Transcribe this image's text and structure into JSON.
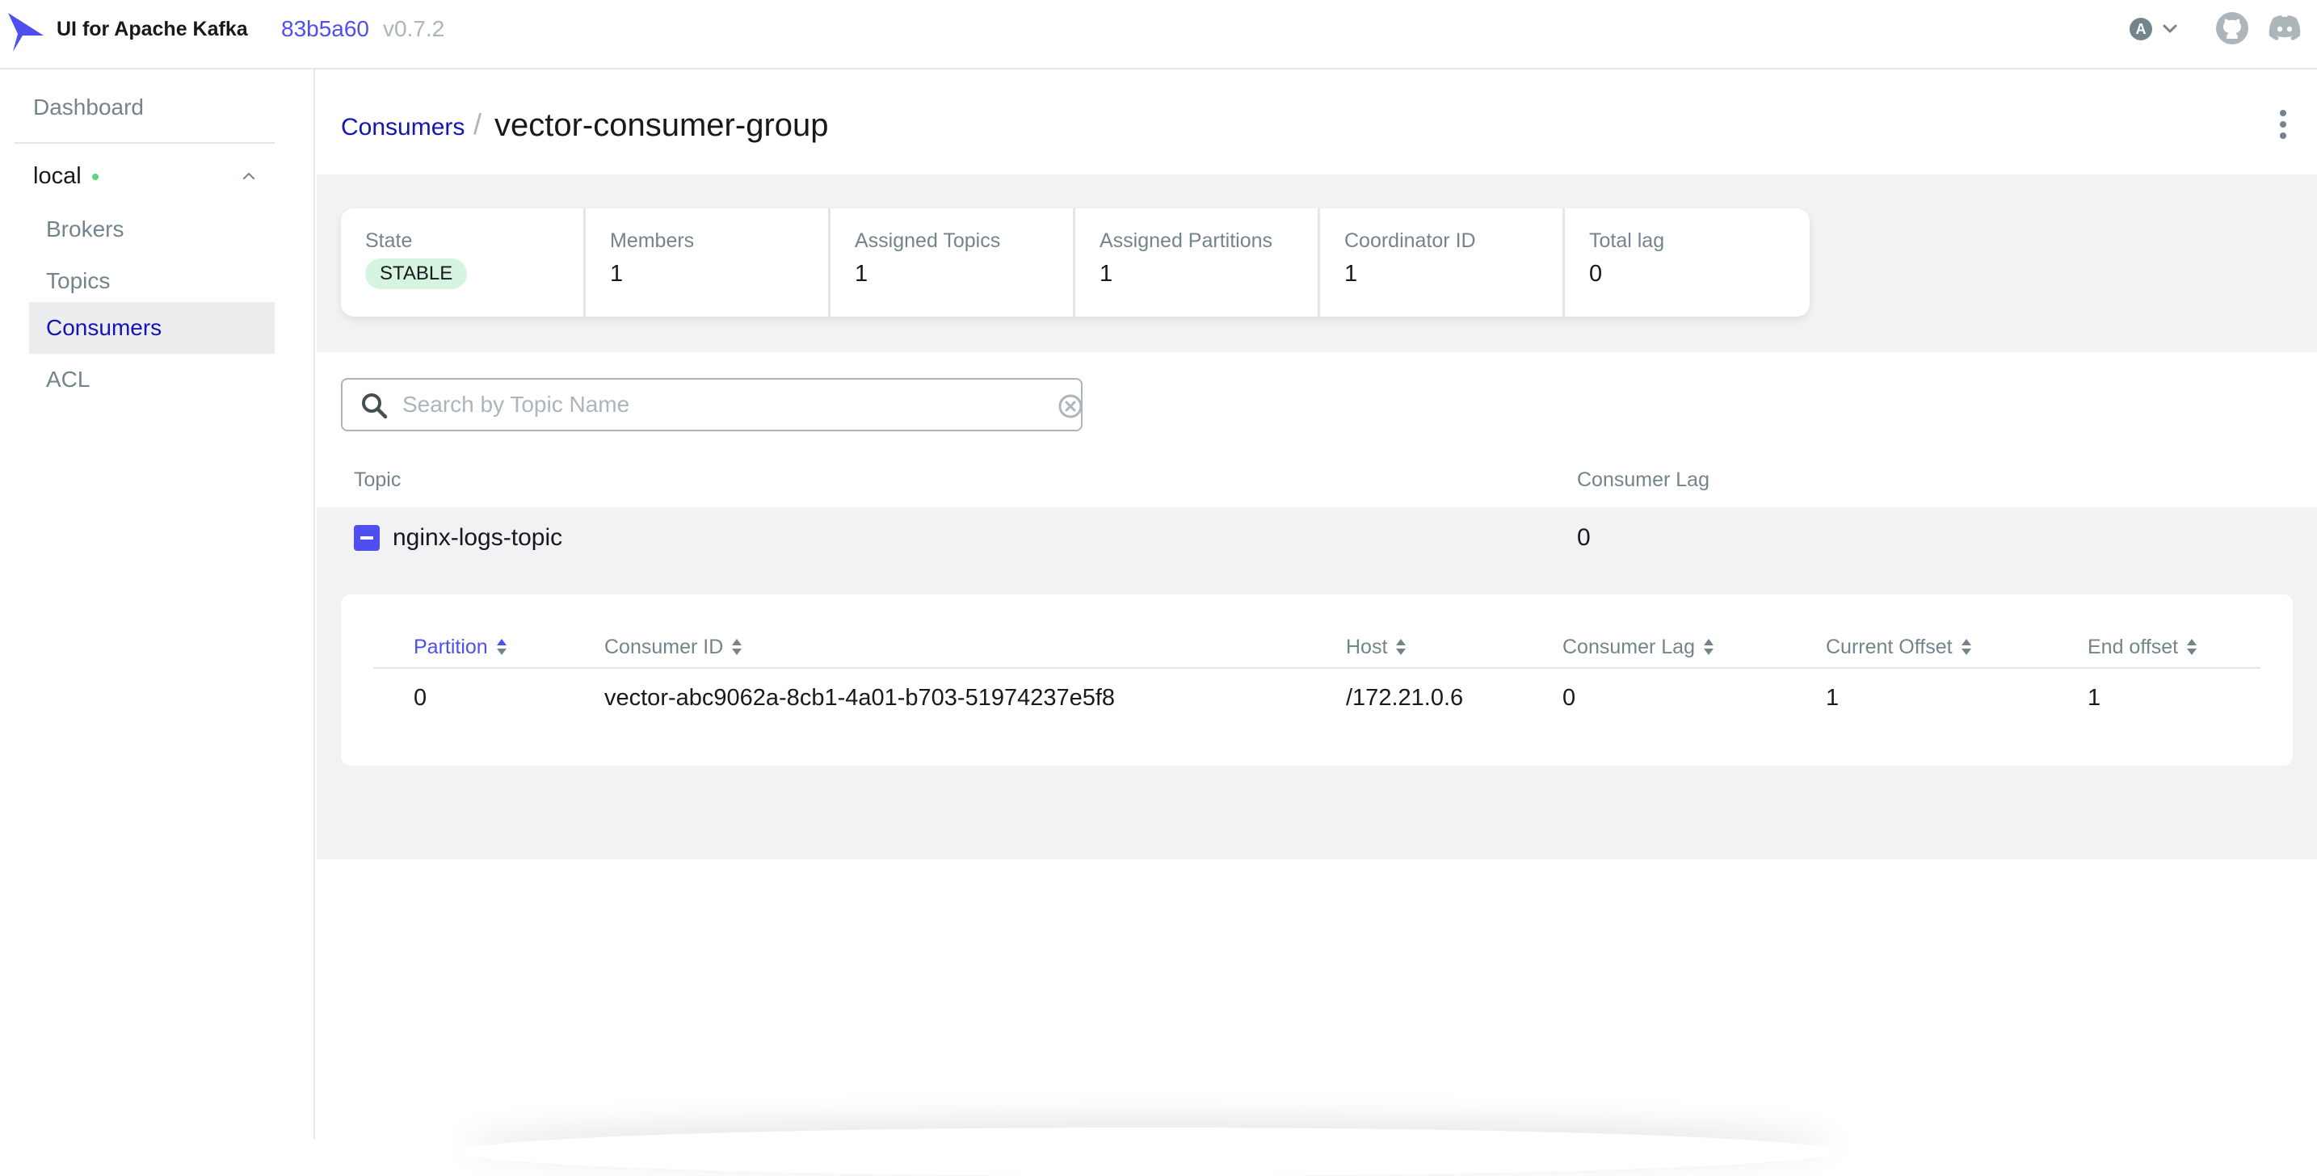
{
  "topnav": {
    "title": "UI for Apache Kafka",
    "version_hash": "83b5a60",
    "version_tag": "v0.7.2",
    "user_initial": "A"
  },
  "sidebar": {
    "dashboard_label": "Dashboard",
    "cluster_name": "local",
    "cluster_status": "online",
    "items": [
      {
        "label": "Brokers",
        "active": false
      },
      {
        "label": "Topics",
        "active": false
      },
      {
        "label": "Consumers",
        "active": true
      },
      {
        "label": "ACL",
        "active": false
      }
    ]
  },
  "header": {
    "breadcrumb_label": "Consumers",
    "separator": "/",
    "title": "vector-consumer-group"
  },
  "metrics": {
    "state_label": "State",
    "state_value": "STABLE",
    "members_label": "Members",
    "members_value": "1",
    "assigned_topics_label": "Assigned Topics",
    "assigned_topics_value": "1",
    "assigned_partitions_label": "Assigned Partitions",
    "assigned_partitions_value": "1",
    "coordinator_label": "Coordinator ID",
    "coordinator_value": "1",
    "total_lag_label": "Total lag",
    "total_lag_value": "0"
  },
  "search": {
    "placeholder": "Search by Topic Name",
    "value": ""
  },
  "topics_table": {
    "headers": {
      "topic": "Topic",
      "consumer_lag": "Consumer Lag"
    },
    "rows": [
      {
        "topic": "nginx-logs-topic",
        "consumer_lag": "0",
        "expanded": true
      }
    ]
  },
  "partitions_table": {
    "headers": {
      "partition": "Partition",
      "consumer_id": "Consumer ID",
      "host": "Host",
      "consumer_lag": "Consumer Lag",
      "current_offset": "Current Offset",
      "end_offset": "End offset"
    },
    "sorted_by": "partition",
    "rows": [
      {
        "partition": "0",
        "consumer_id": "vector-abc9062a-8cb1-4a01-b703-51974237e5f8",
        "host": "/172.21.0.6",
        "consumer_lag": "0",
        "current_offset": "1",
        "end_offset": "1"
      }
    ]
  },
  "colors": {
    "accent": "#4f4ff0",
    "link": "#1414b8",
    "muted": "#73848c",
    "band": "#f1f2f3",
    "status_online": "#5cd685",
    "badge_stable": "#d6f5e0"
  }
}
